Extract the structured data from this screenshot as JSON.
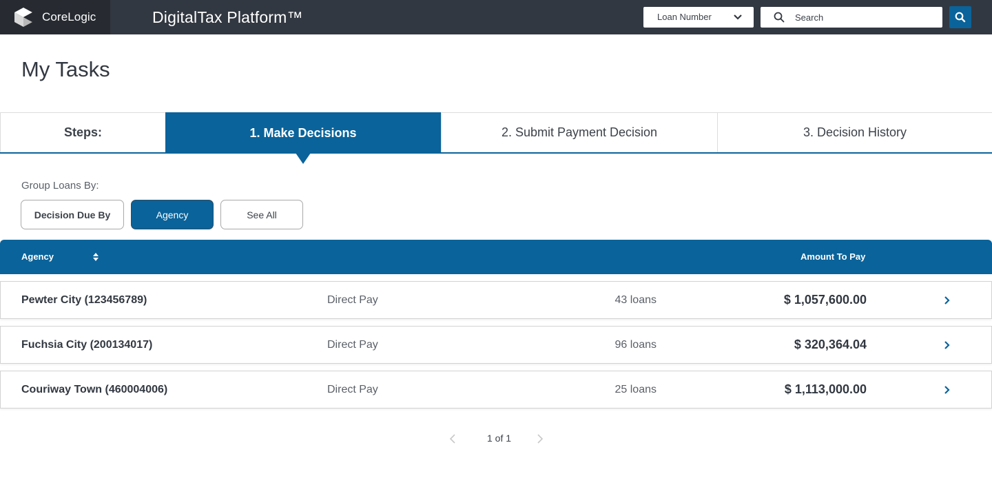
{
  "header": {
    "brand_name": "CoreLogic",
    "app_title": "DigitalTax Platform™",
    "search_type": {
      "selected": "Loan Number",
      "icon": "chevron-down-icon"
    },
    "search": {
      "placeholder": "Search",
      "value": "",
      "icon": "search-icon"
    },
    "search_button_icon": "search-icon"
  },
  "page": {
    "title": "My Tasks"
  },
  "steps": {
    "label": "Steps:",
    "items": [
      {
        "label": "1. Make Decisions",
        "active": true
      },
      {
        "label": "2. Submit Payment Decision",
        "active": false
      },
      {
        "label": "3. Decision History",
        "active": false
      }
    ]
  },
  "group_by": {
    "label": "Group Loans By:",
    "options": [
      {
        "label": "Decision Due By",
        "selected": false
      },
      {
        "label": "Agency",
        "selected": true
      },
      {
        "label": "See All",
        "selected": false
      }
    ]
  },
  "table": {
    "columns": {
      "agency": "Agency",
      "amount": "Amount To Pay"
    },
    "sort_icon": "sort-icon",
    "rows": [
      {
        "agency": "Pewter City (123456789)",
        "payment_type": "Direct Pay",
        "loans": "43 loans",
        "amount": "$ 1,057,600.00"
      },
      {
        "agency": "Fuchsia City (200134017)",
        "payment_type": "Direct Pay",
        "loans": "96 loans",
        "amount": "$ 320,364.04"
      },
      {
        "agency": "Couriway Town (460004006)",
        "payment_type": "Direct Pay",
        "loans": "25 loans",
        "amount": "$ 1,113,000.00"
      }
    ]
  },
  "pagination": {
    "text": "1 of 1",
    "current": 1,
    "total": 1
  },
  "colors": {
    "primary": "#0a639a",
    "header_bg": "#323841",
    "brand_bg": "#272b31",
    "text_dark": "#323841",
    "text_muted": "#5a6068"
  }
}
